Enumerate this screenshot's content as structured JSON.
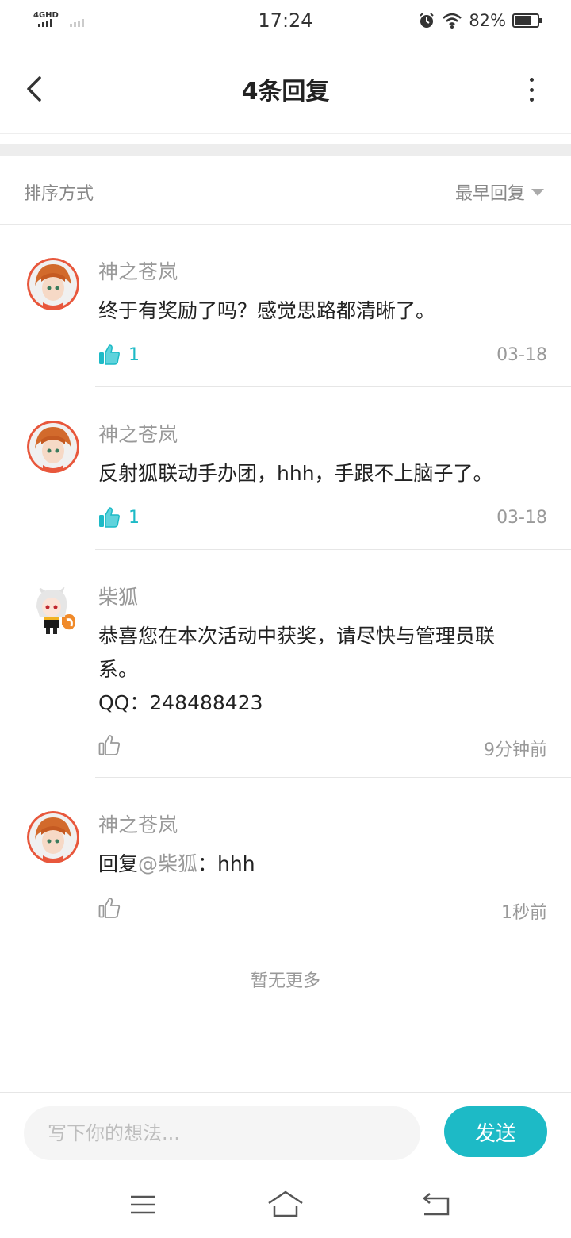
{
  "status_bar": {
    "network": "4GHD",
    "time": "17:24",
    "battery_percent": "82%",
    "battery_level": 0.82
  },
  "header": {
    "title": "4条回复"
  },
  "sort": {
    "label": "排序方式",
    "value": "最早回复"
  },
  "comments": [
    {
      "username": "神之苍岚",
      "text": "终于有奖励了吗？感觉思路都清晰了。",
      "likes": "1",
      "liked": true,
      "time": "03-18",
      "avatar": "orange-hair-girl"
    },
    {
      "username": "神之苍岚",
      "text": "反射狐联动手办团，hhh，手跟不上脑子了。",
      "likes": "1",
      "liked": true,
      "time": "03-18",
      "avatar": "orange-hair-girl"
    },
    {
      "username": "柴狐",
      "text_line1": "恭喜您在本次活动中获奖，请尽快与管理员联",
      "text_line2": "系。",
      "text_line3": "QQ：248488423",
      "likes": "",
      "liked": false,
      "time": "9分钟前",
      "avatar": "fox-girl"
    },
    {
      "username": "神之苍岚",
      "prefix": "回复",
      "mention": "@柴狐",
      "text": "：hhh",
      "likes": "",
      "liked": false,
      "time": "1秒前",
      "avatar": "orange-hair-girl"
    }
  ],
  "footer": {
    "no_more": "暂无更多"
  },
  "composer": {
    "placeholder": "写下你的想法...",
    "send_label": "发送"
  },
  "colors": {
    "accent": "#1dbac6",
    "muted_text": "#999999"
  }
}
